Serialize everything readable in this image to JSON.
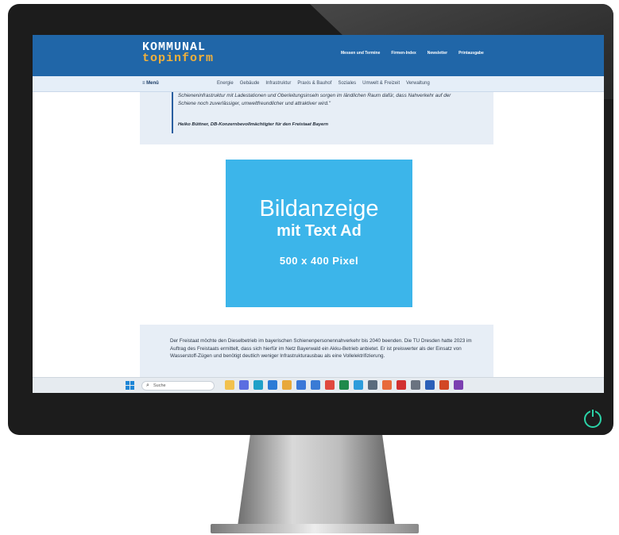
{
  "header": {
    "logo_line1": "KOMMUNAL",
    "logo_line2": "topinform",
    "nav": [
      "Messen und Termine",
      "Firmen-Index",
      "Newsletter",
      "Printausgabe"
    ]
  },
  "subnav": {
    "menu_label": "≡ Menü",
    "items": [
      "Energie",
      "Gebäude",
      "Infrastruktur",
      "Praxis & Bauhof",
      "Soziales",
      "Umwelt & Freizeit",
      "Verwaltung"
    ]
  },
  "quote": {
    "text": "Schieneninfrastruktur mit Ladestationen und Oberleitungsinseln sorgen im ländlichen Raum dafür, dass Nahverkehr auf der Schiene noch zuverlässiger, umweltfreundlicher und attraktiver wird.\"",
    "author": "Heiko Büttner, DB-Konzernbevollmächtigter für den Freistaat Bayern"
  },
  "ad": {
    "title": "Bildanzeige",
    "subtitle": "mit Text Ad",
    "size": "500 x 400 Pixel"
  },
  "article": {
    "text": "Der Freistaat möchte den Dieselbetrieb im bayerischen Schienenpersonennahverkehr bis 2040 beenden. Die TU Dresden hatte 2023 im Auftrag des Freistaats ermittelt, dass sich hierfür im Netz Bayerwald ein Akku-Betrieb anbietet. Er ist preiswerter als der Einsatz von Wasserstoff-Zügen und benötigt deutlich weniger Infrastrukturausbau als eine Vollelektrifizierung."
  },
  "taskbar": {
    "search_placeholder": "Suche",
    "icons": [
      {
        "name": "file-explorer-icon",
        "color": "#f2c14e"
      },
      {
        "name": "chat-icon",
        "color": "#5b6ee1"
      },
      {
        "name": "edge-icon",
        "color": "#1fa0c8"
      },
      {
        "name": "mail-icon",
        "color": "#2b7bd6"
      },
      {
        "name": "folder-icon",
        "color": "#e8a83a"
      },
      {
        "name": "store-icon",
        "color": "#3b78d8"
      },
      {
        "name": "app-icon",
        "color": "#3a7bd5"
      },
      {
        "name": "chrome-icon",
        "color": "#e0483e"
      },
      {
        "name": "excel-icon",
        "color": "#1f8a4c"
      },
      {
        "name": "photos-icon",
        "color": "#2d9cdb"
      },
      {
        "name": "calculator-icon",
        "color": "#5a6b7d"
      },
      {
        "name": "paint-icon",
        "color": "#e86a3a"
      },
      {
        "name": "acrobat-icon",
        "color": "#d23030"
      },
      {
        "name": "settings-icon",
        "color": "#6a7380"
      },
      {
        "name": "word-icon",
        "color": "#2b5fb8"
      },
      {
        "name": "powerpoint-icon",
        "color": "#d24726"
      },
      {
        "name": "onenote-icon",
        "color": "#7b3fb0"
      }
    ]
  },
  "colors": {
    "header_blue": "#2066a8",
    "ad_blue": "#3cb5ea",
    "logo_orange": "#f3b13a",
    "power_led": "#2bd3a7"
  }
}
